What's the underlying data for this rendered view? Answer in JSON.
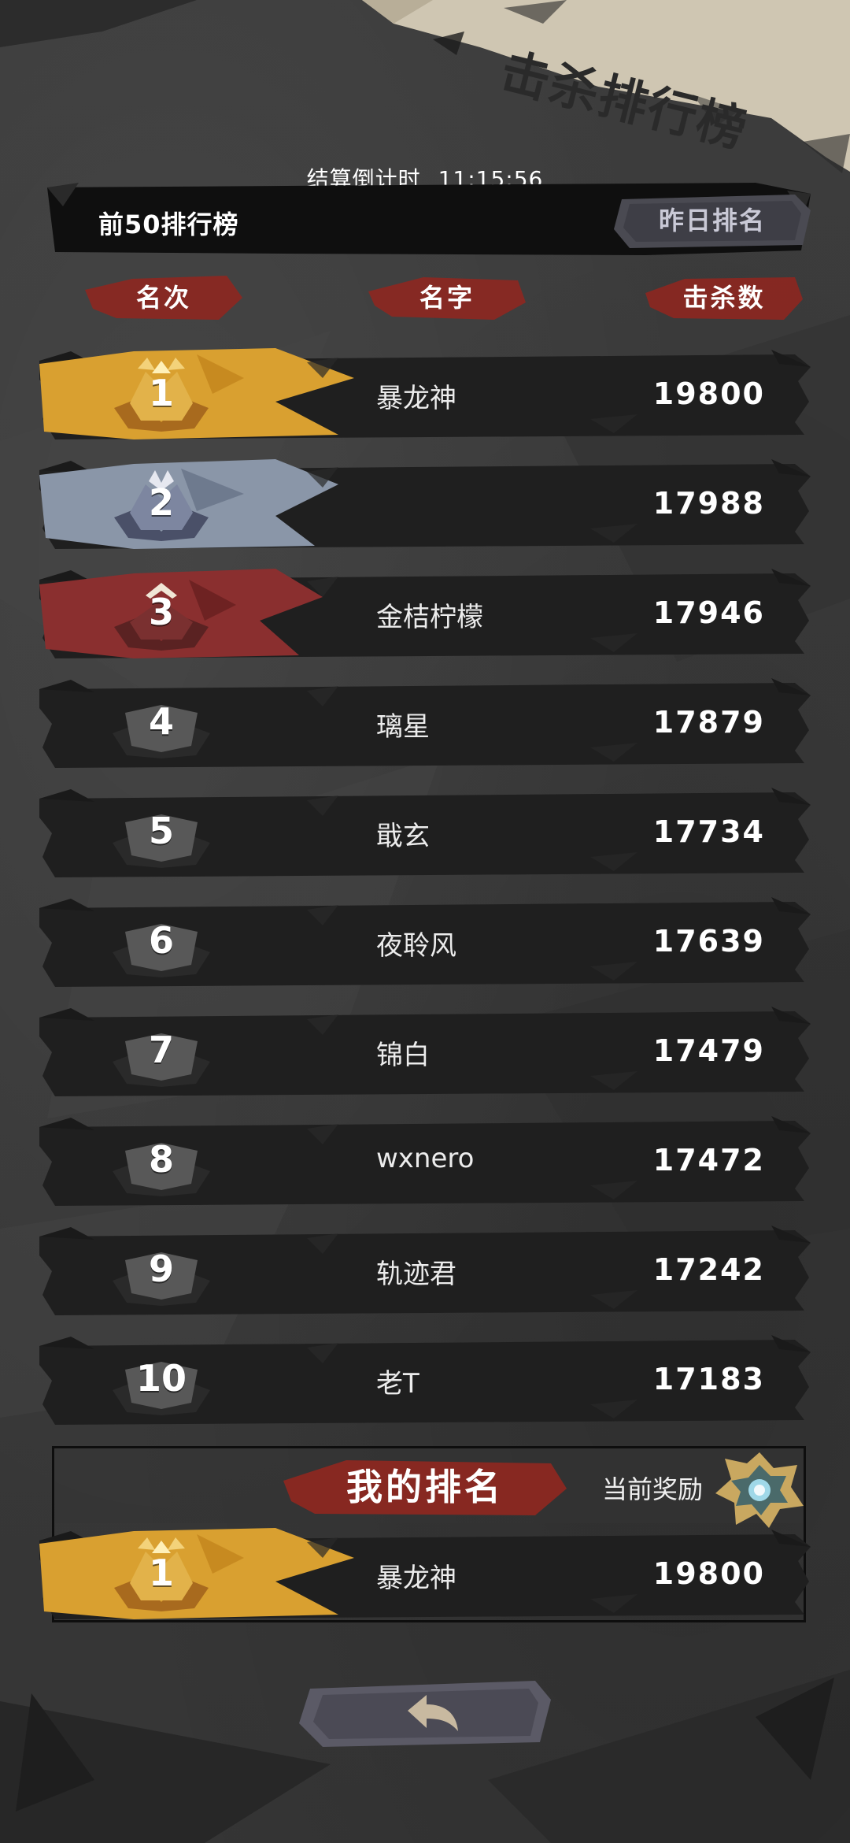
{
  "title": "击杀排行榜",
  "countdown": {
    "label": "结算倒计时",
    "time": "11:15:56"
  },
  "top_bar": {
    "board_label": "前50排行榜",
    "yesterday_button": "昨日排名"
  },
  "columns": {
    "rank": "名次",
    "name": "名字",
    "kills": "击杀数"
  },
  "rows": [
    {
      "rank": "1",
      "name": "暴龙神",
      "kills": "19800",
      "tier": "gold"
    },
    {
      "rank": "2",
      "name": "",
      "kills": "17988",
      "tier": "silver"
    },
    {
      "rank": "3",
      "name": "金桔柠檬",
      "kills": "17946",
      "tier": "bronze"
    },
    {
      "rank": "4",
      "name": "璃星",
      "kills": "17879",
      "tier": "plain"
    },
    {
      "rank": "5",
      "name": "戢玄",
      "kills": "17734",
      "tier": "plain"
    },
    {
      "rank": "6",
      "name": "夜聆风",
      "kills": "17639",
      "tier": "plain"
    },
    {
      "rank": "7",
      "name": "锦白",
      "kills": "17479",
      "tier": "plain"
    },
    {
      "rank": "8",
      "name": "wxnero",
      "kills": "17472",
      "tier": "plain"
    },
    {
      "rank": "9",
      "name": "轨迹君",
      "kills": "17242",
      "tier": "plain"
    },
    {
      "rank": "10",
      "name": "老T",
      "kills": "17183",
      "tier": "plain"
    }
  ],
  "my_rank": {
    "title": "我的排名",
    "reward_label": "当前奖励",
    "rank": "1",
    "name": "暴龙神",
    "kills": "19800",
    "tier": "gold"
  },
  "colors": {
    "gold": "#d9a030",
    "silver": "#8a96a8",
    "bronze": "#8a2f2f",
    "row_dark": "#1f1f1f",
    "accent_red": "#9a2a24",
    "banner_cream": "#d8d0bc"
  },
  "icons": {
    "back_button": "back-arrow-icon",
    "reward": "reward-medal-icon",
    "gold_badge": "gold-crown-badge-icon",
    "silver_badge": "silver-crown-badge-icon",
    "bronze_badge": "bronze-chevron-badge-icon",
    "plain_badge": "plain-ribbon-badge-icon"
  }
}
